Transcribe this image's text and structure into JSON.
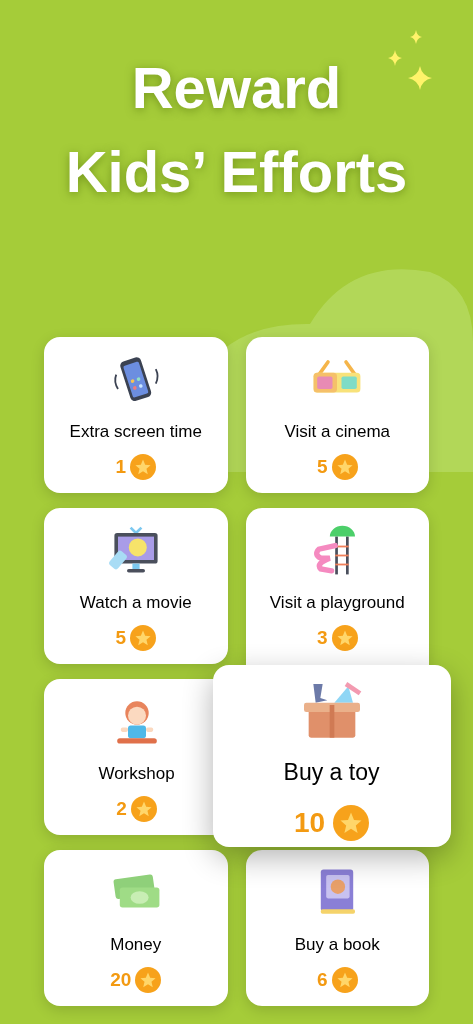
{
  "title": {
    "lines": [
      "Reward",
      "Kids’ Efforts"
    ]
  },
  "rewards": [
    {
      "kind": "phone",
      "label": "Extra screen time",
      "points": "1",
      "highlighted": false
    },
    {
      "kind": "glasses",
      "label": "Visit a cinema",
      "points": "5",
      "highlighted": false
    },
    {
      "kind": "tv",
      "label": "Watch a movie",
      "points": "5",
      "highlighted": false
    },
    {
      "kind": "slide",
      "label": "Visit a playground",
      "points": "3",
      "highlighted": false
    },
    {
      "kind": "kid",
      "label": "Workshop",
      "points": "2",
      "highlighted": false
    },
    {
      "kind": "toybox",
      "label": "Buy a toy",
      "points": "10",
      "highlighted": true
    },
    {
      "kind": "money",
      "label": "Money",
      "points": "20",
      "highlighted": false
    },
    {
      "kind": "book",
      "label": "Buy a book",
      "points": "6",
      "highlighted": false
    }
  ]
}
